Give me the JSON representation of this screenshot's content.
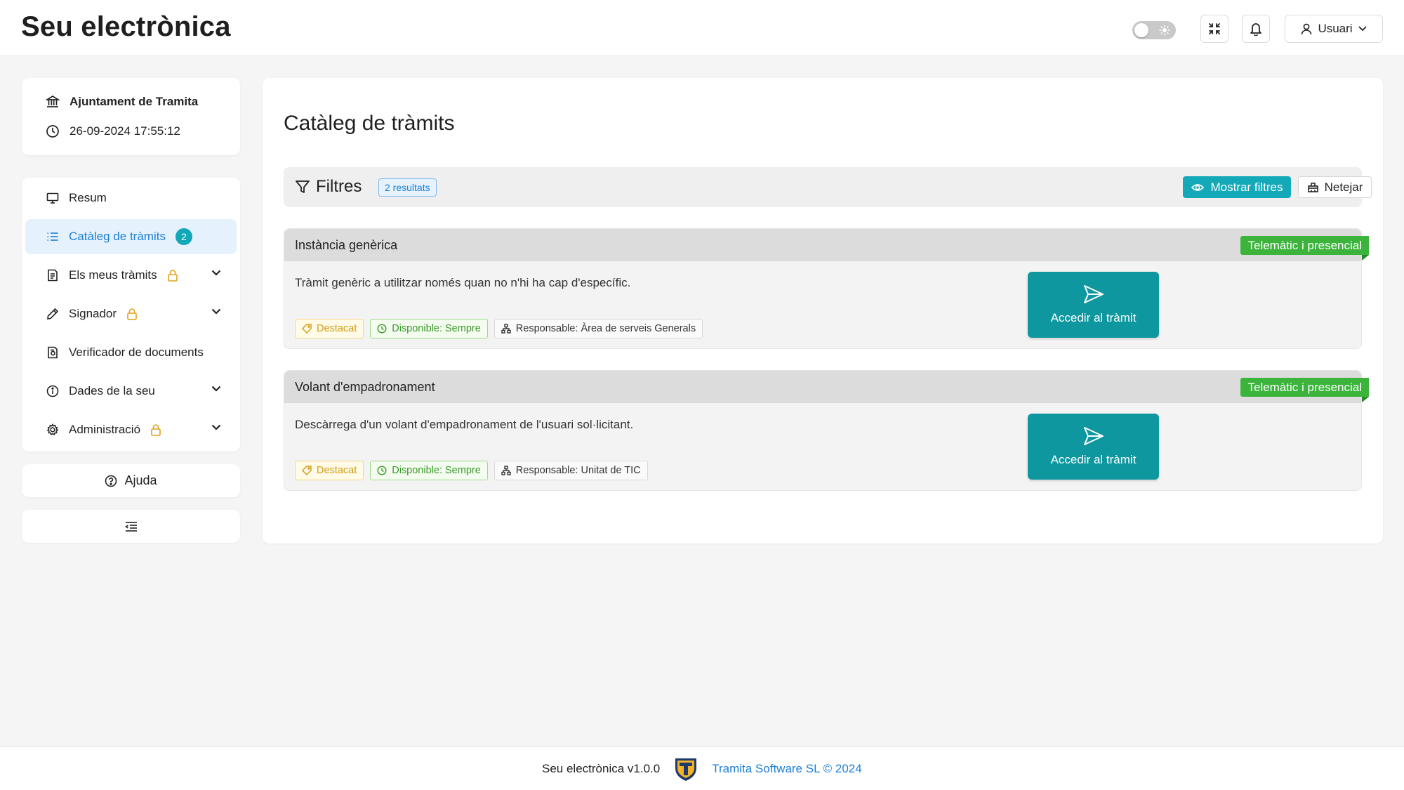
{
  "header": {
    "title": "Seu electrònica",
    "theme_toggle_icon": "sun-icon",
    "fullscreen_icon": "fullscreen-icon",
    "notifications_icon": "bell-icon",
    "user_label": "Usuari"
  },
  "sidebar": {
    "info": {
      "organization": "Ajuntament de Tramita",
      "datetime": "26-09-2024 17:55:12"
    },
    "items": [
      {
        "label": "Resum",
        "icon": "monitor-icon"
      },
      {
        "label": "Catàleg de tràmits",
        "icon": "list-icon",
        "badge": "2",
        "active": true
      },
      {
        "label": "Els meus tràmits",
        "icon": "document-icon",
        "locked": true,
        "expandable": true
      },
      {
        "label": "Signador",
        "icon": "pen-icon",
        "locked": true,
        "expandable": true
      },
      {
        "label": "Verificador de documents",
        "icon": "document-check-icon"
      },
      {
        "label": "Dades de la seu",
        "icon": "info-icon",
        "expandable": true
      },
      {
        "label": "Administració",
        "icon": "gear-icon",
        "locked": true,
        "expandable": true
      }
    ],
    "help_label": "Ajuda",
    "collapse_icon": "collapse-menu-icon"
  },
  "main": {
    "title": "Catàleg de tràmits",
    "filters": {
      "title": "Filtres",
      "results": "2 resultats",
      "show_label": "Mostrar filtres",
      "clear_label": "Netejar"
    },
    "procedures": [
      {
        "title": "Instància genèrica",
        "channel": "Telemàtic i presencial",
        "description": "Tràmit genèric a utilitzar només quan no n'hi ha cap d'específic.",
        "tag_featured": "Destacat",
        "tag_available": "Disponible: Sempre",
        "tag_responsible": "Responsable: Àrea de serveis Generals",
        "action": "Accedir al tràmit"
      },
      {
        "title": "Volant d'empadronament",
        "channel": "Telemàtic i presencial",
        "description": "Descàrrega d'un volant d'empadronament de l'usuari sol·licitant.",
        "tag_featured": "Destacat",
        "tag_available": "Disponible: Sempre",
        "tag_responsible": "Responsable: Unitat de TIC",
        "action": "Accedir al tràmit"
      }
    ]
  },
  "footer": {
    "version": "Seu electrònica v1.0.0",
    "company": "Tramita Software SL © 2024"
  },
  "colors": {
    "accent": "#13a9b9",
    "active_nav": "#1d7fd6",
    "channel_ribbon": "#3cb43c",
    "lock": "#e0a21a"
  }
}
